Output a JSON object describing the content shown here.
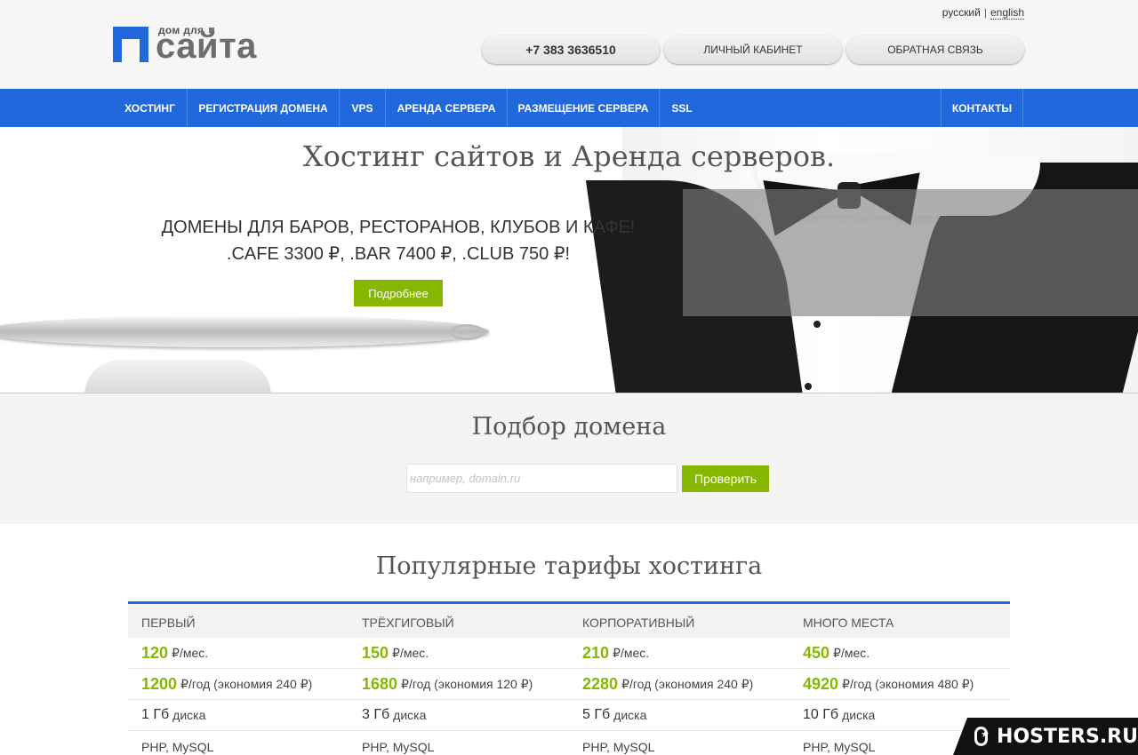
{
  "header": {
    "logo_small": "дом для",
    "logo_big": "сайта",
    "lang": {
      "ru": "русский",
      "sep": "|",
      "en": "english"
    },
    "phone": "+7 383 3636510",
    "cabinet": "ЛИЧНЫЙ КАБИНЕТ",
    "feedback": "ОБРАТНАЯ СВЯЗЬ"
  },
  "nav": {
    "items": [
      "ХОСТИНГ",
      "РЕГИСТРАЦИЯ ДОМЕНА",
      "VPS",
      "АРЕНДА СЕРВЕРА",
      "РАЗМЕЩЕНИЕ СЕРВЕРА",
      "SSL"
    ],
    "contacts": "КОНТАКТЫ"
  },
  "hero": {
    "title": "Хостинг сайтов и Аренда серверов.",
    "promo_line1": "ДОМЕНЫ ДЛЯ БАРОВ, РЕСТОРАНОВ, КЛУБОВ И КАФЕ!",
    "promo_line2": ".CAFE 3300 ₽, .BAR 7400 ₽, .CLUB 750 ₽!",
    "button": "Подробнее"
  },
  "domain": {
    "title": "Подбор домена",
    "placeholder": "например, domain.ru",
    "button": "Проверить"
  },
  "tariffs": {
    "title": "Популярные тарифы хостинга",
    "plans": [
      {
        "name": "ПЕРВЫЙ",
        "month_price": "120",
        "month_unit": "₽/мес.",
        "year_price": "1200",
        "year_unit": "₽/год (экономия 240 ₽)",
        "disk_size": "1 Гб",
        "disk_label": "диска",
        "tech": "PHP, MySQL"
      },
      {
        "name": "ТРЁХГИГОВЫЙ",
        "month_price": "150",
        "month_unit": "₽/мес.",
        "year_price": "1680",
        "year_unit": "₽/год (экономия 120 ₽)",
        "disk_size": "3 Гб",
        "disk_label": "диска",
        "tech": "PHP, MySQL"
      },
      {
        "name": "КОРПОРАТИВНЫЙ",
        "month_price": "210",
        "month_unit": "₽/мес.",
        "year_price": "2280",
        "year_unit": "₽/год (экономия 240 ₽)",
        "disk_size": "5 Гб",
        "disk_label": "диска",
        "tech": "PHP, MySQL"
      },
      {
        "name": "МНОГО МЕСТА",
        "month_price": "450",
        "month_unit": "₽/мес.",
        "year_price": "4920",
        "year_unit": "₽/год (экономия 480 ₽)",
        "disk_size": "10 Гб",
        "disk_label": "диска",
        "tech": "PHP, MySQL"
      }
    ]
  },
  "watermark": {
    "text": "HOSTERS.RU",
    "icon": "chat-star-icon"
  },
  "colors": {
    "brand_blue": "#2068dc",
    "accent_green": "#86b800"
  }
}
